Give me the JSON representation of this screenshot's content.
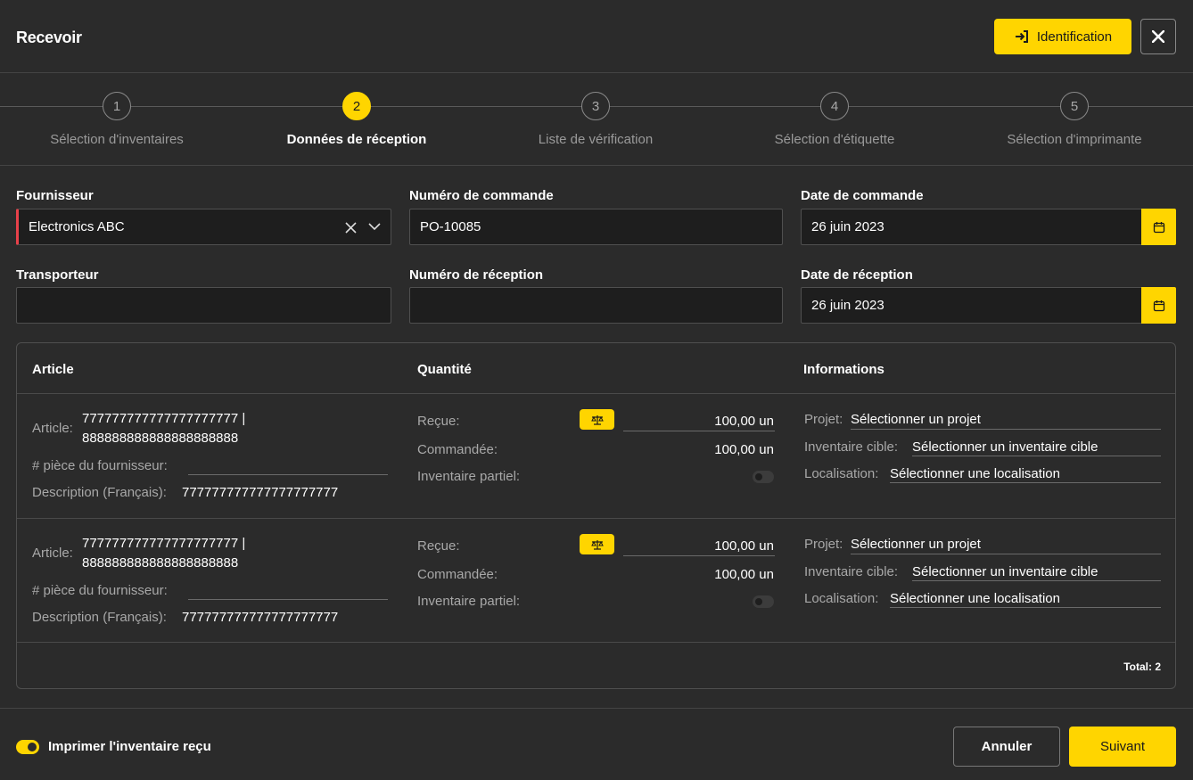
{
  "header": {
    "title": "Recevoir",
    "identification_label": "Identification"
  },
  "stepper": {
    "steps": [
      {
        "number": "1",
        "label": "Sélection d'inventaires"
      },
      {
        "number": "2",
        "label": "Données de réception"
      },
      {
        "number": "3",
        "label": "Liste de vérification"
      },
      {
        "number": "4",
        "label": "Sélection d'étiquette"
      },
      {
        "number": "5",
        "label": "Sélection d'imprimante"
      }
    ],
    "active_step": 2
  },
  "form": {
    "fournisseur_label": "Fournisseur",
    "fournisseur_value": "Electronics ABC",
    "numero_commande_label": "Numéro de commande",
    "numero_commande_value": "PO-10085",
    "date_commande_label": "Date de commande",
    "date_commande_value": "26 juin 2023",
    "transporteur_label": "Transporteur",
    "transporteur_value": "",
    "numero_reception_label": "Numéro de réception",
    "numero_reception_value": "",
    "date_reception_label": "Date de réception",
    "date_reception_value": "26 juin 2023"
  },
  "table": {
    "headers": [
      "Article",
      "Quantité",
      "Informations"
    ],
    "labels": {
      "article": "Article:",
      "piece": "# pièce du fournisseur:",
      "description": "Description (Français):",
      "recue": "Reçue:",
      "commandee": "Commandée:",
      "partiel": "Inventaire partiel:",
      "projet": "Projet:",
      "inventaire_cible": "Inventaire cible:",
      "localisation": "Localisation:"
    },
    "rows": [
      {
        "article_line1": "777777777777777777777 |",
        "article_line2": "888888888888888888888",
        "piece": "",
        "description": "777777777777777777777",
        "recue": "100,00 un",
        "commandee": "100,00 un",
        "partiel": false,
        "projet": "Sélectionner un projet",
        "inventaire_cible": "Sélectionner un inventaire cible",
        "localisation": "Sélectionner une localisation"
      },
      {
        "article_line1": "777777777777777777777 |",
        "article_line2": "888888888888888888888",
        "piece": "",
        "description": "777777777777777777777",
        "recue": "100,00 un",
        "commandee": "100,00 un",
        "partiel": false,
        "projet": "Sélectionner un projet",
        "inventaire_cible": "Sélectionner un inventaire cible",
        "localisation": "Sélectionner une localisation"
      }
    ],
    "total": "Total: 2"
  },
  "footer": {
    "print_toggle_label": "Imprimer l'inventaire reçu",
    "print_toggle_on": true,
    "cancel_label": "Annuler",
    "next_label": "Suivant"
  },
  "colors": {
    "accent": "#ffd500",
    "background": "#2b2b2b",
    "field_bg": "#1e1e1e",
    "required": "#e8414a"
  },
  "icons": {
    "identification": "sign-in-icon",
    "close": "close-icon",
    "clear": "clear-x-icon",
    "dropdown": "chevron-down-icon",
    "calendar": "calendar-icon",
    "scale": "scale-icon"
  }
}
